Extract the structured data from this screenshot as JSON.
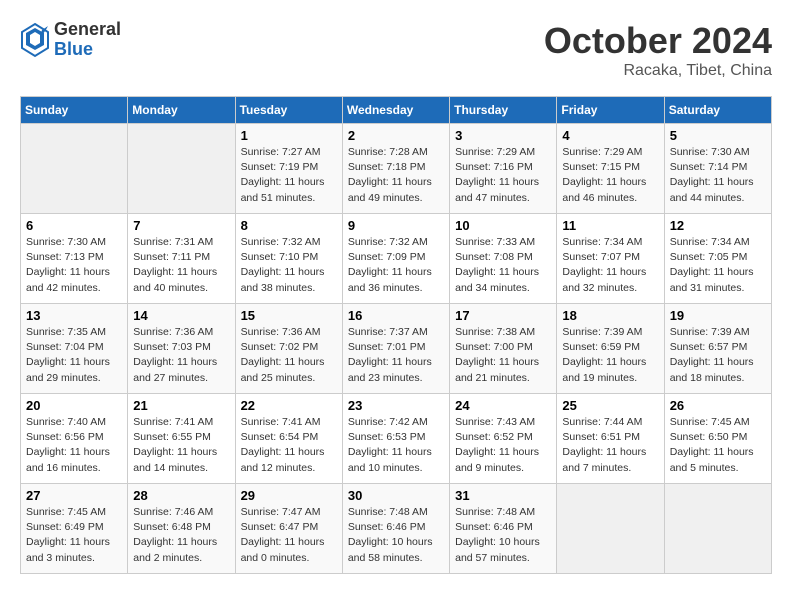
{
  "header": {
    "logo_general": "General",
    "logo_blue": "Blue",
    "month_year": "October 2024",
    "location": "Racaka, Tibet, China"
  },
  "days_of_week": [
    "Sunday",
    "Monday",
    "Tuesday",
    "Wednesday",
    "Thursday",
    "Friday",
    "Saturday"
  ],
  "weeks": [
    [
      {
        "day": "",
        "empty": true
      },
      {
        "day": "",
        "empty": true
      },
      {
        "day": "1",
        "sunrise": "7:27 AM",
        "sunset": "7:19 PM",
        "daylight": "11 hours and 51 minutes."
      },
      {
        "day": "2",
        "sunrise": "7:28 AM",
        "sunset": "7:18 PM",
        "daylight": "11 hours and 49 minutes."
      },
      {
        "day": "3",
        "sunrise": "7:29 AM",
        "sunset": "7:16 PM",
        "daylight": "11 hours and 47 minutes."
      },
      {
        "day": "4",
        "sunrise": "7:29 AM",
        "sunset": "7:15 PM",
        "daylight": "11 hours and 46 minutes."
      },
      {
        "day": "5",
        "sunrise": "7:30 AM",
        "sunset": "7:14 PM",
        "daylight": "11 hours and 44 minutes."
      }
    ],
    [
      {
        "day": "6",
        "sunrise": "7:30 AM",
        "sunset": "7:13 PM",
        "daylight": "11 hours and 42 minutes."
      },
      {
        "day": "7",
        "sunrise": "7:31 AM",
        "sunset": "7:11 PM",
        "daylight": "11 hours and 40 minutes."
      },
      {
        "day": "8",
        "sunrise": "7:32 AM",
        "sunset": "7:10 PM",
        "daylight": "11 hours and 38 minutes."
      },
      {
        "day": "9",
        "sunrise": "7:32 AM",
        "sunset": "7:09 PM",
        "daylight": "11 hours and 36 minutes."
      },
      {
        "day": "10",
        "sunrise": "7:33 AM",
        "sunset": "7:08 PM",
        "daylight": "11 hours and 34 minutes."
      },
      {
        "day": "11",
        "sunrise": "7:34 AM",
        "sunset": "7:07 PM",
        "daylight": "11 hours and 32 minutes."
      },
      {
        "day": "12",
        "sunrise": "7:34 AM",
        "sunset": "7:05 PM",
        "daylight": "11 hours and 31 minutes."
      }
    ],
    [
      {
        "day": "13",
        "sunrise": "7:35 AM",
        "sunset": "7:04 PM",
        "daylight": "11 hours and 29 minutes."
      },
      {
        "day": "14",
        "sunrise": "7:36 AM",
        "sunset": "7:03 PM",
        "daylight": "11 hours and 27 minutes."
      },
      {
        "day": "15",
        "sunrise": "7:36 AM",
        "sunset": "7:02 PM",
        "daylight": "11 hours and 25 minutes."
      },
      {
        "day": "16",
        "sunrise": "7:37 AM",
        "sunset": "7:01 PM",
        "daylight": "11 hours and 23 minutes."
      },
      {
        "day": "17",
        "sunrise": "7:38 AM",
        "sunset": "7:00 PM",
        "daylight": "11 hours and 21 minutes."
      },
      {
        "day": "18",
        "sunrise": "7:39 AM",
        "sunset": "6:59 PM",
        "daylight": "11 hours and 19 minutes."
      },
      {
        "day": "19",
        "sunrise": "7:39 AM",
        "sunset": "6:57 PM",
        "daylight": "11 hours and 18 minutes."
      }
    ],
    [
      {
        "day": "20",
        "sunrise": "7:40 AM",
        "sunset": "6:56 PM",
        "daylight": "11 hours and 16 minutes."
      },
      {
        "day": "21",
        "sunrise": "7:41 AM",
        "sunset": "6:55 PM",
        "daylight": "11 hours and 14 minutes."
      },
      {
        "day": "22",
        "sunrise": "7:41 AM",
        "sunset": "6:54 PM",
        "daylight": "11 hours and 12 minutes."
      },
      {
        "day": "23",
        "sunrise": "7:42 AM",
        "sunset": "6:53 PM",
        "daylight": "11 hours and 10 minutes."
      },
      {
        "day": "24",
        "sunrise": "7:43 AM",
        "sunset": "6:52 PM",
        "daylight": "11 hours and 9 minutes."
      },
      {
        "day": "25",
        "sunrise": "7:44 AM",
        "sunset": "6:51 PM",
        "daylight": "11 hours and 7 minutes."
      },
      {
        "day": "26",
        "sunrise": "7:45 AM",
        "sunset": "6:50 PM",
        "daylight": "11 hours and 5 minutes."
      }
    ],
    [
      {
        "day": "27",
        "sunrise": "7:45 AM",
        "sunset": "6:49 PM",
        "daylight": "11 hours and 3 minutes."
      },
      {
        "day": "28",
        "sunrise": "7:46 AM",
        "sunset": "6:48 PM",
        "daylight": "11 hours and 2 minutes."
      },
      {
        "day": "29",
        "sunrise": "7:47 AM",
        "sunset": "6:47 PM",
        "daylight": "11 hours and 0 minutes."
      },
      {
        "day": "30",
        "sunrise": "7:48 AM",
        "sunset": "6:46 PM",
        "daylight": "10 hours and 58 minutes."
      },
      {
        "day": "31",
        "sunrise": "7:48 AM",
        "sunset": "6:46 PM",
        "daylight": "10 hours and 57 minutes."
      },
      {
        "day": "",
        "empty": true
      },
      {
        "day": "",
        "empty": true
      }
    ]
  ]
}
